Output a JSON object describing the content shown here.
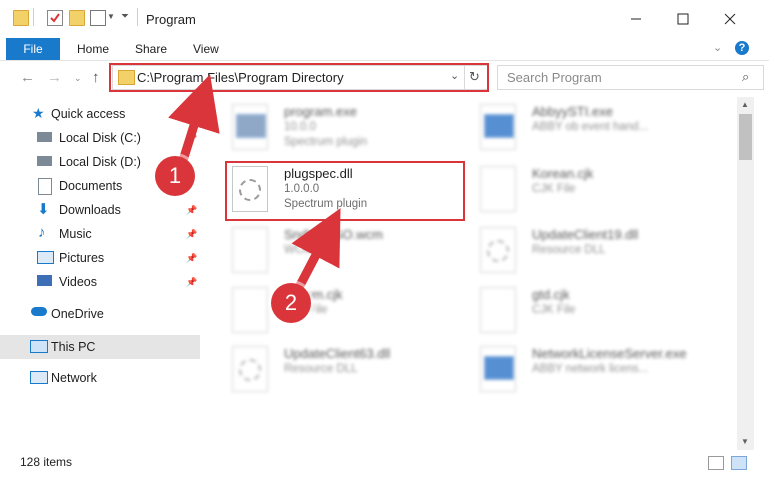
{
  "window": {
    "title": "Program"
  },
  "ribbon": {
    "file": "File",
    "tabs": [
      "Home",
      "Share",
      "View"
    ],
    "help": "?"
  },
  "address": {
    "path": "C:\\Program Files\\Program Directory"
  },
  "search": {
    "placeholder": "Search Program"
  },
  "sidebar": {
    "quick_access": "Quick access",
    "items": [
      "Local Disk (C:)",
      "Local Disk (D:)",
      "Documents",
      "Downloads",
      "Music",
      "Pictures",
      "Videos"
    ],
    "onedrive": "OneDrive",
    "this_pc": "This PC",
    "network": "Network"
  },
  "files": [
    {
      "name": "program.exe",
      "line1": "10.0.0",
      "line2": "Spectrum plugin"
    },
    {
      "name": "AbbyySTI.exe",
      "line1": "ABBY ob event hand...",
      "line2": ""
    },
    {
      "name": "plugspec.dll",
      "line1": "1.0.0.0",
      "line2": "Spectrum plugin"
    },
    {
      "name": "Korean.cjk",
      "line1": "CJK File",
      "line2": ""
    },
    {
      "name": "SndVolSSO.wcm",
      "line1": "WCM File",
      "line2": ""
    },
    {
      "name": "UpdateClient19.dll",
      "line1": "Resource DLL",
      "line2": ""
    },
    {
      "name": "bdcom.cjk",
      "line1": "CJK File",
      "line2": ""
    },
    {
      "name": "gtd.cjk",
      "line1": "CJK File",
      "line2": ""
    },
    {
      "name": "UpdateClient63.dll",
      "line1": "Resource DLL",
      "line2": ""
    },
    {
      "name": "NetworkLicenseServer.exe",
      "line1": "ABBY network licens...",
      "line2": ""
    }
  ],
  "status": {
    "count": "128 items"
  },
  "annotations": {
    "step1": "1",
    "step2": "2"
  },
  "colors": {
    "accent": "#1979ca",
    "highlight": "#d9353a"
  }
}
